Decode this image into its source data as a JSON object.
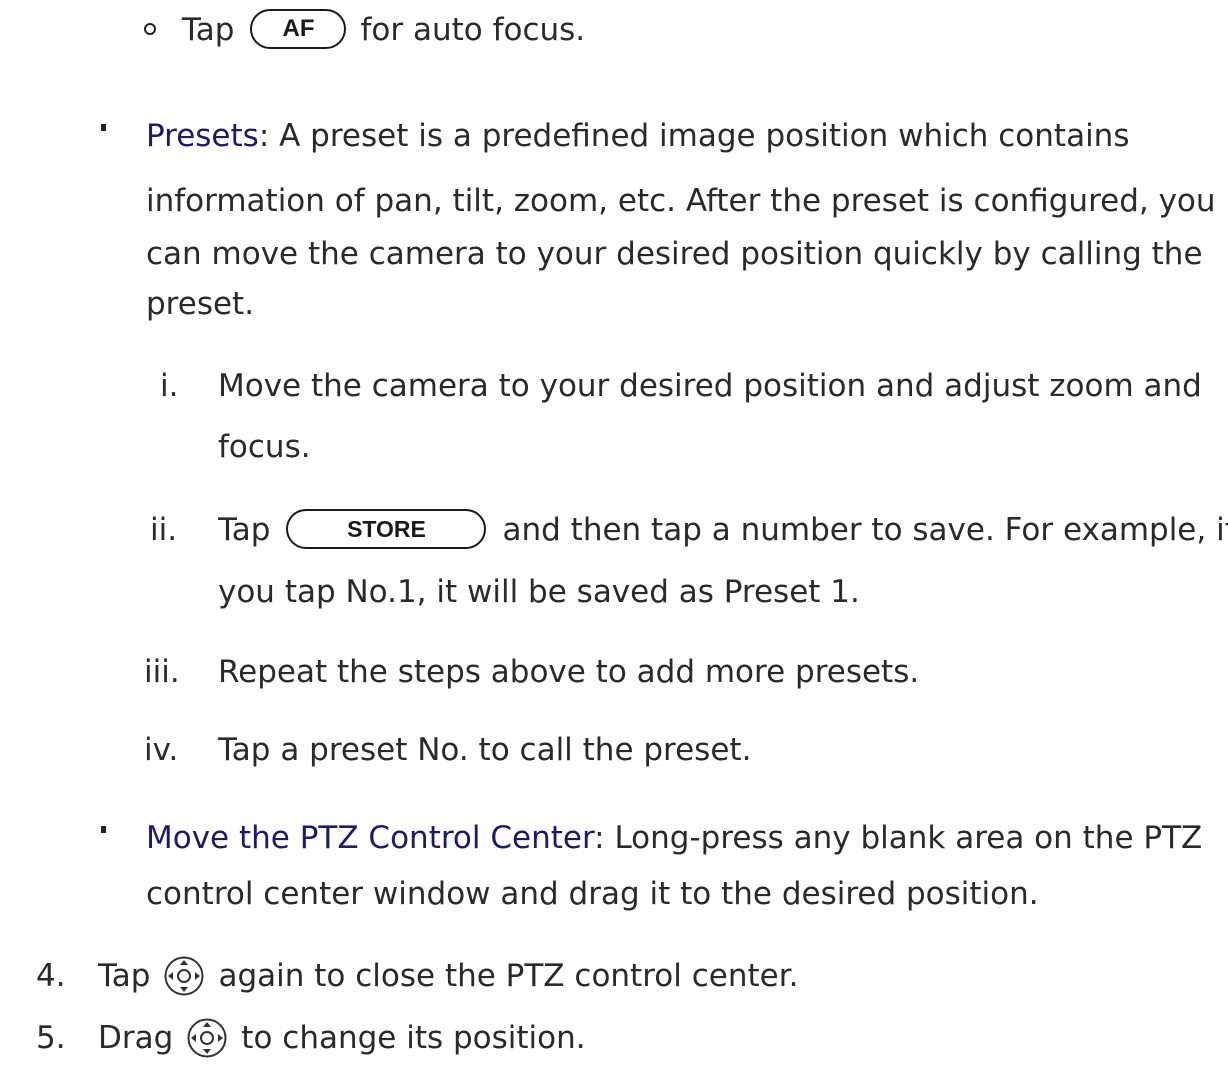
{
  "af_line": {
    "before": "Tap",
    "button": "AF",
    "after": "for auto focus."
  },
  "presets": {
    "term": "Presets",
    "line1": ": A preset is a predefined image position which contains",
    "line2": "information of pan, tilt, zoom, etc. After the preset is configured, you",
    "line3": "can move the camera to your desired position quickly by calling the",
    "line4": "preset."
  },
  "steps": [
    {
      "num": "i.",
      "line1": "Move the camera to your desired position and adjust zoom and",
      "line2": "focus."
    },
    {
      "num": "ii.",
      "before": "Tap",
      "button": "STORE",
      "after": "and then tap a number to save. For example, if",
      "line2": "you tap No.1, it will be saved as Preset 1."
    },
    {
      "num": "iii.",
      "line1": "Repeat the steps above to add more presets."
    },
    {
      "num": "iv.",
      "line1": "Tap a preset No. to call the preset."
    }
  ],
  "move_center": {
    "term": "Move the PTZ Control Center",
    "line1": ": Long-press any blank area on the PTZ",
    "line2": "control center window and drag it to the desired position."
  },
  "numbered": [
    {
      "num": "4.",
      "before": "Tap",
      "icon": "ptz-joystick-icon",
      "after": "again to close the PTZ control center."
    },
    {
      "num": "5.",
      "before": "Drag",
      "icon": "ptz-joystick-icon",
      "after": "to change its position."
    }
  ]
}
